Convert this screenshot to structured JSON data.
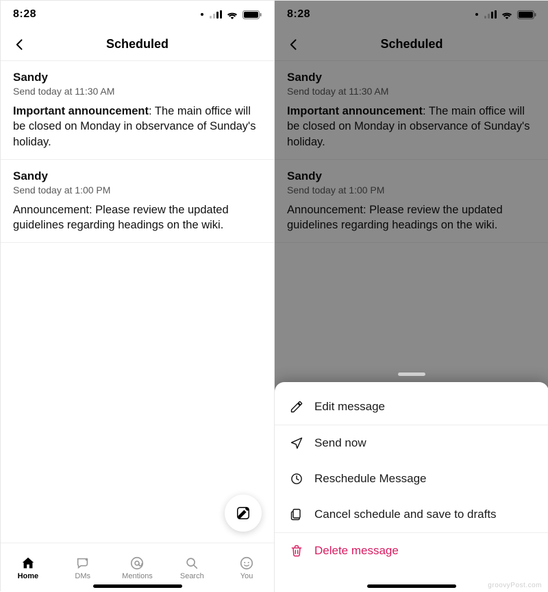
{
  "status": {
    "time": "8:28"
  },
  "header": {
    "title": "Scheduled"
  },
  "messages": [
    {
      "sender": "Sandy",
      "schedule": "Send today at 11:30 AM",
      "body_strong": "Important announcement",
      "body_rest": ": The main office will be closed on Monday in observance of Sunday's holiday."
    },
    {
      "sender": "Sandy",
      "schedule": "Send today at 1:00 PM",
      "body_strong": "",
      "body_rest": "Announcement: Please review the updated guidelines regarding headings on the wiki."
    }
  ],
  "tabs": {
    "home": "Home",
    "dms": "DMs",
    "mentions": "Mentions",
    "search": "Search",
    "you": "You"
  },
  "sheet": {
    "edit": "Edit message",
    "send_now": "Send now",
    "reschedule": "Reschedule Message",
    "cancel_save": "Cancel schedule and save to drafts",
    "delete": "Delete message"
  },
  "watermark": "groovyPost.com"
}
